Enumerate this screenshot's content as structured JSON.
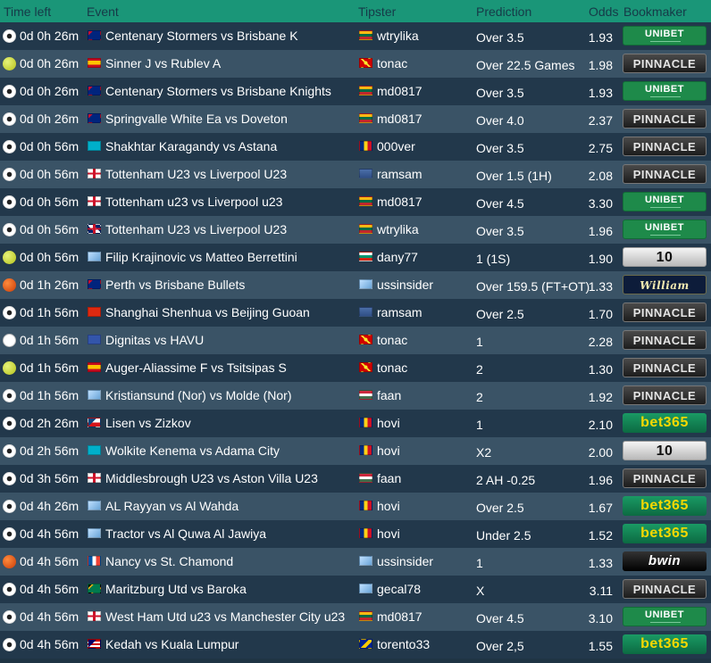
{
  "headers": {
    "time": "Time left",
    "event": "Event",
    "tipster": "Tipster",
    "prediction": "Prediction",
    "odds": "Odds",
    "bookmaker": "Bookmaker"
  },
  "rows": [
    {
      "sport": "soccer",
      "time": "0d 0h 26m",
      "event_flag": "australia",
      "event": "Centenary Stormers vs Brisbane K",
      "tipster_flag": "lithuania",
      "tipster": "wtrylika",
      "prediction": "Over 3.5",
      "odds": "1.93",
      "bookmaker": "unibet"
    },
    {
      "sport": "tennis",
      "time": "0d 0h 26m",
      "event_flag": "spain",
      "event": "Sinner J vs Rublev A",
      "tipster_flag": "macedonia",
      "tipster": "tonac",
      "prediction": "Over 22.5 Games",
      "odds": "1.98",
      "bookmaker": "pinnacle"
    },
    {
      "sport": "soccer",
      "time": "0d 0h 26m",
      "event_flag": "australia",
      "event": "Centenary Stormers vs Brisbane Knights",
      "tipster_flag": "lithuania",
      "tipster": "md0817",
      "prediction": "Over 3.5",
      "odds": "1.93",
      "bookmaker": "unibet"
    },
    {
      "sport": "soccer",
      "time": "0d 0h 26m",
      "event_flag": "australia",
      "event": "Springvalle White Ea vs Doveton",
      "tipster_flag": "lithuania",
      "tipster": "md0817",
      "prediction": "Over 4.0",
      "odds": "2.37",
      "bookmaker": "pinnacle"
    },
    {
      "sport": "soccer",
      "time": "0d 0h 56m",
      "event_flag": "kazakhstan",
      "event": "Shakhtar Karagandy vs Astana",
      "tipster_flag": "romania",
      "tipster": "000ver",
      "prediction": "Over 3.5",
      "odds": "2.75",
      "bookmaker": "pinnacle"
    },
    {
      "sport": "soccer",
      "time": "0d 0h 56m",
      "event_flag": "england",
      "event": "Tottenham U23 vs Liverpool U23",
      "tipster_flag": "unknown",
      "tipster": "ramsam",
      "prediction": "Over 1.5 (1H)",
      "odds": "2.08",
      "bookmaker": "pinnacle"
    },
    {
      "sport": "soccer",
      "time": "0d 0h 56m",
      "event_flag": "england",
      "event": "Tottenham u23 vs Liverpool u23",
      "tipster_flag": "lithuania",
      "tipster": "md0817",
      "prediction": "Over 4.5",
      "odds": "3.30",
      "bookmaker": "unibet"
    },
    {
      "sport": "soccer",
      "time": "0d 0h 56m",
      "event_flag": "uk",
      "event": "Tottenham U23 vs Liverpool U23",
      "tipster_flag": "lithuania",
      "tipster": "wtrylika",
      "prediction": "Over 3.5",
      "odds": "1.96",
      "bookmaker": "unibet"
    },
    {
      "sport": "tennis",
      "time": "0d 0h 56m",
      "event_flag": "world",
      "event": "Filip Krajinovic vs Matteo Berrettini",
      "tipster_flag": "bulgaria",
      "tipster": "dany77",
      "prediction": "1 (1S)",
      "odds": "1.90",
      "bookmaker": "10bet"
    },
    {
      "sport": "basketball",
      "time": "0d 1h 26m",
      "event_flag": "australia",
      "event": "Perth vs Brisbane Bullets",
      "tipster_flag": "world",
      "tipster": "ussinsider",
      "prediction": "Over 159.5 (FT+OT)",
      "odds": "1.33",
      "bookmaker": "williamhill"
    },
    {
      "sport": "soccer",
      "time": "0d 1h 56m",
      "event_flag": "china",
      "event": "Shanghai Shenhua vs Beijing Guoan",
      "tipster_flag": "unknown",
      "tipster": "ramsam",
      "prediction": "Over 2.5",
      "odds": "1.70",
      "bookmaker": "pinnacle"
    },
    {
      "sport": "esport",
      "time": "0d 1h 56m",
      "event_flag": "europe",
      "event": "Dignitas vs HAVU",
      "tipster_flag": "macedonia",
      "tipster": "tonac",
      "prediction": "1",
      "odds": "2.28",
      "bookmaker": "pinnacle"
    },
    {
      "sport": "tennis",
      "time": "0d 1h 56m",
      "event_flag": "spain",
      "event": "Auger-Aliassime F vs Tsitsipas S",
      "tipster_flag": "macedonia",
      "tipster": "tonac",
      "prediction": "2",
      "odds": "1.30",
      "bookmaker": "pinnacle"
    },
    {
      "sport": "soccer",
      "time": "0d 1h 56m",
      "event_flag": "world",
      "event": "Kristiansund (Nor) vs Molde (Nor)",
      "tipster_flag": "hungary",
      "tipster": "faan",
      "prediction": "2",
      "odds": "1.92",
      "bookmaker": "pinnacle"
    },
    {
      "sport": "soccer",
      "time": "0d 2h 26m",
      "event_flag": "czech",
      "event": "Lisen vs Zizkov",
      "tipster_flag": "romania",
      "tipster": "hovi",
      "prediction": "1",
      "odds": "2.10",
      "bookmaker": "bet365"
    },
    {
      "sport": "soccer",
      "time": "0d 2h 56m",
      "event_flag": "kazakhstan",
      "event": "Wolkite Kenema vs Adama City",
      "tipster_flag": "romania",
      "tipster": "hovi",
      "prediction": "X2",
      "odds": "2.00",
      "bookmaker": "10bet"
    },
    {
      "sport": "soccer",
      "time": "0d 3h 56m",
      "event_flag": "england",
      "event": "Middlesbrough U23 vs Aston Villa U23",
      "tipster_flag": "hungary",
      "tipster": "faan",
      "prediction": "2 AH -0.25",
      "odds": "1.96",
      "bookmaker": "pinnacle"
    },
    {
      "sport": "soccer",
      "time": "0d 4h 26m",
      "event_flag": "world",
      "event": "AL Rayyan vs Al Wahda",
      "tipster_flag": "romania",
      "tipster": "hovi",
      "prediction": "Over 2.5",
      "odds": "1.67",
      "bookmaker": "bet365"
    },
    {
      "sport": "soccer",
      "time": "0d 4h 56m",
      "event_flag": "world",
      "event": "Tractor vs Al Quwa Al Jawiya",
      "tipster_flag": "romania",
      "tipster": "hovi",
      "prediction": "Under 2.5",
      "odds": "1.52",
      "bookmaker": "bet365"
    },
    {
      "sport": "basketball",
      "time": "0d 4h 56m",
      "event_flag": "france",
      "event": "Nancy vs St. Chamond",
      "tipster_flag": "world",
      "tipster": "ussinsider",
      "prediction": "1",
      "odds": "1.33",
      "bookmaker": "bwin"
    },
    {
      "sport": "soccer",
      "time": "0d 4h 56m",
      "event_flag": "southafrica",
      "event": "Maritzburg Utd vs Baroka",
      "tipster_flag": "world",
      "tipster": "gecal78",
      "prediction": "X",
      "odds": "3.11",
      "bookmaker": "pinnacle"
    },
    {
      "sport": "soccer",
      "time": "0d 4h 56m",
      "event_flag": "england",
      "event": "West Ham Utd u23 vs Manchester City u23",
      "tipster_flag": "lithuania",
      "tipster": "md0817",
      "prediction": "Over 4.5",
      "odds": "3.10",
      "bookmaker": "unibet"
    },
    {
      "sport": "soccer",
      "time": "0d 4h 56m",
      "event_flag": "malaysia",
      "event": "Kedah vs Kuala Lumpur",
      "tipster_flag": "bosnia",
      "tipster": "torento33",
      "prediction": "Over 2,5",
      "odds": "1.55",
      "bookmaker": "bet365"
    }
  ],
  "bookmaker_labels": {
    "unibet": "UNIBET",
    "pinnacle": "PINNACLE",
    "10bet": "10",
    "williamhill": "William HILL",
    "bet365": "bet365",
    "bwin": "bwin"
  },
  "colors": {
    "header_bg": "#1a9678",
    "header_text": "#163a48",
    "row_dark": "#22384b",
    "row_light": "#3a5366"
  }
}
